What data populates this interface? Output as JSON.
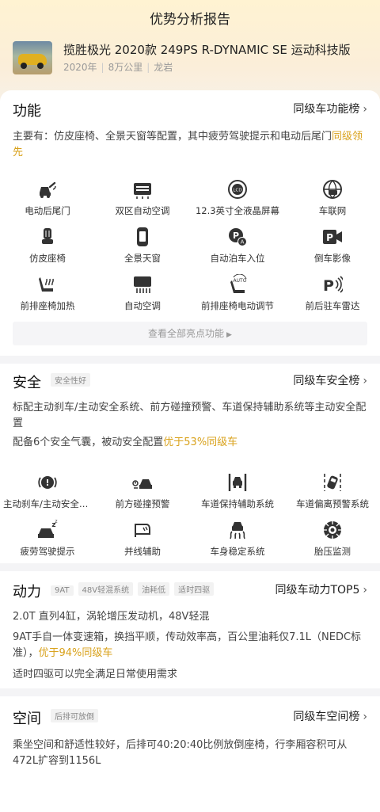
{
  "page": {
    "title": "优势分析报告"
  },
  "car": {
    "name": "揽胜极光 2020款 249PS R-DYNAMIC SE 运动科技版",
    "year": "2020年",
    "mileage": "8万公里",
    "city": "龙岩"
  },
  "function": {
    "title": "功能",
    "rank_link": "同级车功能榜",
    "summary_prefix": "主要有：仿皮座椅、全景天窗等配置，其中疲劳驾驶提示和电动后尾门",
    "summary_highlight": "同级领先",
    "items": [
      {
        "label": "电动后尾门",
        "icon": "liftgate-icon"
      },
      {
        "label": "双区自动空调",
        "icon": "dual-zone-ac-icon"
      },
      {
        "label": "12.3英寸全液晶屏幕",
        "icon": "lcd-gauge-icon"
      },
      {
        "label": "车联网",
        "icon": "connected-car-icon"
      },
      {
        "label": "仿皮座椅",
        "icon": "leather-seat-icon"
      },
      {
        "label": "全景天窗",
        "icon": "panoramic-sunroof-icon"
      },
      {
        "label": "自动泊车入位",
        "icon": "auto-parking-icon"
      },
      {
        "label": "倒车影像",
        "icon": "reverse-camera-icon"
      },
      {
        "label": "前排座椅加热",
        "icon": "seat-heating-icon"
      },
      {
        "label": "自动空调",
        "icon": "auto-ac-icon"
      },
      {
        "label": "前排座椅电动调节",
        "icon": "power-seat-icon"
      },
      {
        "label": "前后驻车雷达",
        "icon": "parking-radar-icon"
      }
    ],
    "more_label": "查看全部亮点功能"
  },
  "safety": {
    "title": "安全",
    "tag": "安全性好",
    "rank_link": "同级车安全榜",
    "text1": "标配主动刹车/主动安全系统、前方碰撞预警、车道保持辅助系统等主动安全配置",
    "text2_prefix": "配备6个安全气囊，被动安全配置",
    "text2_highlight": "优于53%同级车",
    "items": [
      {
        "label": "主动刹车/主动安全系统",
        "icon": "active-brake-icon"
      },
      {
        "label": "前方碰撞预警",
        "icon": "collision-warning-icon"
      },
      {
        "label": "车道保持辅助系统",
        "icon": "lane-keep-icon"
      },
      {
        "label": "车道偏离预警系统",
        "icon": "lane-departure-icon"
      },
      {
        "label": "疲劳驾驶提示",
        "icon": "fatigue-alert-icon"
      },
      {
        "label": "并线辅助",
        "icon": "blind-spot-icon"
      },
      {
        "label": "车身稳定系统",
        "icon": "stability-control-icon"
      },
      {
        "label": "胎压监测",
        "icon": "tire-pressure-icon"
      }
    ]
  },
  "power": {
    "title": "动力",
    "tags": [
      "9AT",
      "48V轻混系统",
      "油耗低",
      "适时四驱"
    ],
    "rank_link": "同级车动力TOP5",
    "text1": "2.0T 直列4缸，涡轮增压发动机，48V轻混",
    "text2_prefix": "9AT手自一体变速箱，换挡平顺，传动效率高，百公里油耗仅7.1L（NEDC标准），",
    "text2_highlight": "优于94%同级车",
    "text3": "适时四驱可以完全满足日常使用需求"
  },
  "space": {
    "title": "空间",
    "tag": "后排可放倒",
    "rank_link": "同级车空间榜",
    "text": "乘坐空间和舒适性较好，后排可40:20:40比例放倒座椅，行李厢容积可从472L扩容到1156L"
  },
  "colors": {
    "highlight": "#d9a21c",
    "icon": "#333333"
  }
}
